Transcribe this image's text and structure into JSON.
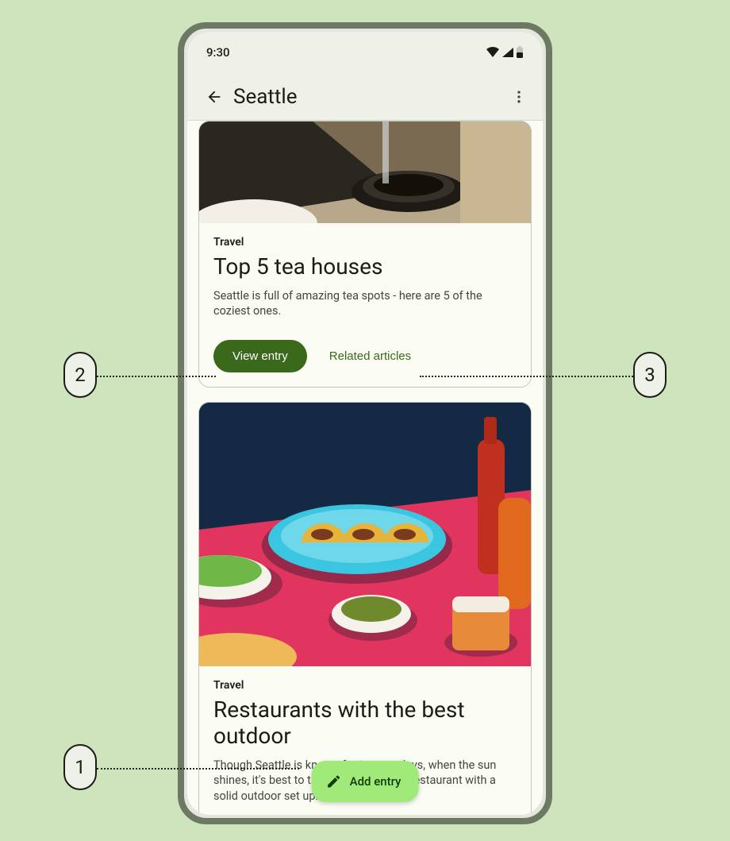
{
  "statusbar": {
    "time": "9:30"
  },
  "appbar": {
    "title": "Seattle"
  },
  "cards": [
    {
      "category": "Travel",
      "title": "Top 5 tea houses",
      "description": "Seattle is full of amazing tea spots - here are 5 of the coziest ones.",
      "primary_action": "View entry",
      "secondary_action": "Related articles"
    },
    {
      "category": "Travel",
      "title": "Restaurants with the best outdoor",
      "description": "Though Seattle is known for its grey days, when the sun shines, it's best to take advantage at a restaurant with a solid outdoor set up."
    }
  ],
  "fab": {
    "label": "Add entry"
  },
  "callouts": {
    "c1": "1",
    "c2": "2",
    "c3": "3"
  }
}
